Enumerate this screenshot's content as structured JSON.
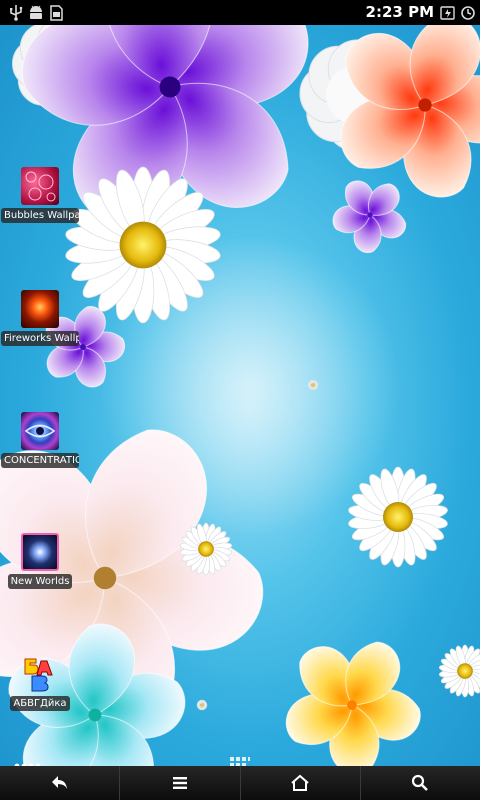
{
  "status_bar": {
    "time": "2:23 PM",
    "left_icons": [
      "usb-icon",
      "android-debug-icon",
      "sd-card-icon"
    ],
    "right_icons": [
      "battery-charging-icon",
      "alarm-clock-icon"
    ]
  },
  "home_screen": {
    "apps": [
      {
        "label": "Bubbles Wallpap",
        "icon": "bubbles-wallpaper-icon"
      },
      {
        "label": "Fireworks Wallp",
        "icon": "fireworks-wallpaper-icon"
      },
      {
        "label": "CONCENTRATIO",
        "icon": "concentration-eye-icon"
      },
      {
        "label": "New Worlds",
        "icon": "new-worlds-icon"
      },
      {
        "label": "АБВГДйка",
        "icon": "abvg-letters-icon"
      }
    ],
    "app_drawer_icon": "grid-icon",
    "page_indicator_icon": "dots-icon"
  },
  "nav_bar": {
    "buttons": [
      "back-icon",
      "menu-icon",
      "home-icon",
      "search-icon"
    ]
  },
  "colors": {
    "wallpaper_center": "#a9e3f6",
    "wallpaper_edge": "#1d93cc",
    "bars": "#000000"
  }
}
